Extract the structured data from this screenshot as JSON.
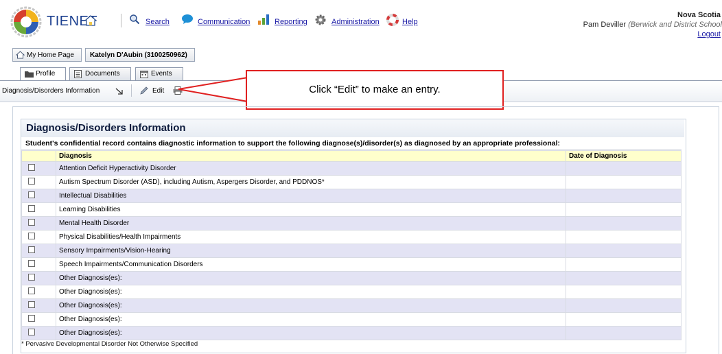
{
  "header": {
    "app_name": "TIENET",
    "nav": [
      {
        "label": "Search",
        "icon": "search-icon"
      },
      {
        "label": "Communication",
        "icon": "chat-bubble-icon"
      },
      {
        "label": "Reporting",
        "icon": "bar-chart-icon"
      },
      {
        "label": "Administration",
        "icon": "gear-icon"
      },
      {
        "label": "Help",
        "icon": "lifebuoy-icon"
      }
    ],
    "org": "Nova Scotia",
    "user_name": "Pam Deviller",
    "user_context": "(Berwick and District School",
    "logout": "Logout"
  },
  "breadcrumb": {
    "home": "My Home Page",
    "student": "Katelyn D'Aubin (3100250962)"
  },
  "tabs": [
    {
      "label": "Profile",
      "active": true
    },
    {
      "label": "Documents",
      "active": false
    },
    {
      "label": "Events",
      "active": false
    }
  ],
  "toolbar": {
    "section_label": "Diagnosis/Disorders Information",
    "edit_label": "Edit"
  },
  "callout": "Click “Edit” to make an entry.",
  "section": {
    "title": "Diagnosis/Disorders Information",
    "intro": "Student's confidential record contains diagnostic information to support the following diagnose(s)/disorder(s) as diagnosed by an appropriate professional:",
    "columns": [
      "Diagnosis",
      "Date of Diagnosis"
    ],
    "rows": [
      "Attention Deficit Hyperactivity Disorder",
      "Autism Spectrum Disorder (ASD), including Autism, Aspergers Disorder, and PDDNOS*",
      "Intellectual Disabilities",
      "Learning Disabilities",
      "Mental Health Disorder",
      "Physical Disabilities/Health Impairments",
      "Sensory Impairments/Vision-Hearing",
      "Speech Impairments/Communication Disorders",
      "Other Diagnosis(es):",
      "Other Diagnosis(es):",
      "Other Diagnosis(es):",
      "Other Diagnosis(es):",
      "Other Diagnosis(es):"
    ],
    "footnote": "* Pervasive Developmental Disorder Not Otherwise Specified"
  },
  "colors": {
    "accent": "#1a1aa6",
    "callout_border": "#e02020",
    "row_alt": "#e3e3f4",
    "header_row": "#ffffcc"
  }
}
